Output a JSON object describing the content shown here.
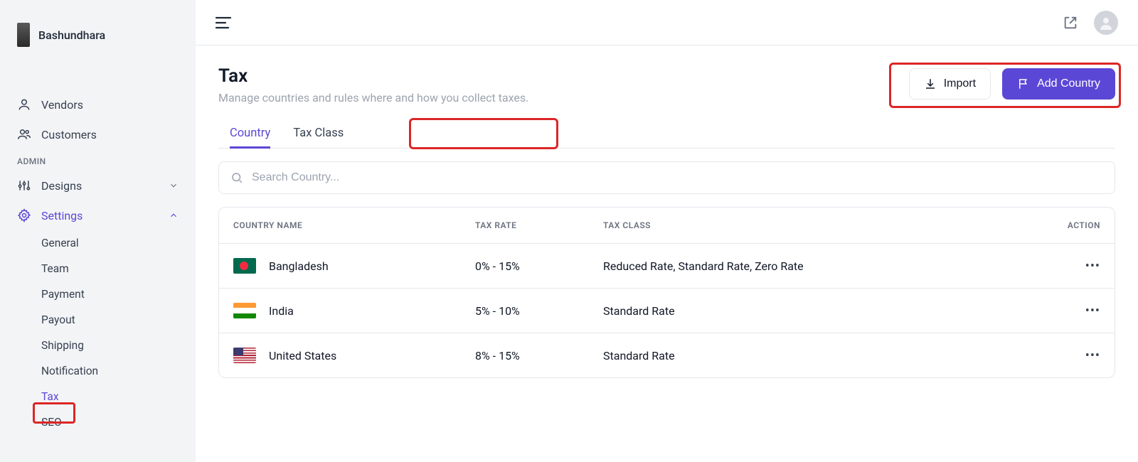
{
  "brand": {
    "name": "Bashundhara"
  },
  "sidebar": {
    "items": [
      {
        "label": "Vendors"
      },
      {
        "label": "Customers"
      }
    ],
    "group_admin": "ADMIN",
    "designs": "Designs",
    "settings": "Settings",
    "settings_children": [
      {
        "label": "General"
      },
      {
        "label": "Team"
      },
      {
        "label": "Payment"
      },
      {
        "label": "Payout"
      },
      {
        "label": "Shipping"
      },
      {
        "label": "Notification"
      },
      {
        "label": "Tax"
      },
      {
        "label": "SEO"
      }
    ]
  },
  "page": {
    "title": "Tax",
    "subtitle": "Manage countries and rules where and how you collect taxes."
  },
  "actions": {
    "import": "Import",
    "add_country": "Add Country"
  },
  "tabs": {
    "country": "Country",
    "tax_class": "Tax Class"
  },
  "search": {
    "placeholder": "Search Country..."
  },
  "table": {
    "headers": {
      "name": "COUNTRY NAME",
      "rate": "TAX RATE",
      "class": "TAX CLASS",
      "action": "ACTION"
    },
    "rows": [
      {
        "name": "Bangladesh",
        "rate": "0% - 15%",
        "class": "Reduced Rate, Standard Rate, Zero Rate",
        "flag": "bd"
      },
      {
        "name": "India",
        "rate": "5% - 10%",
        "class": "Standard Rate",
        "flag": "in"
      },
      {
        "name": "United States",
        "rate": "8% - 15%",
        "class": "Standard Rate",
        "flag": "us"
      }
    ]
  }
}
